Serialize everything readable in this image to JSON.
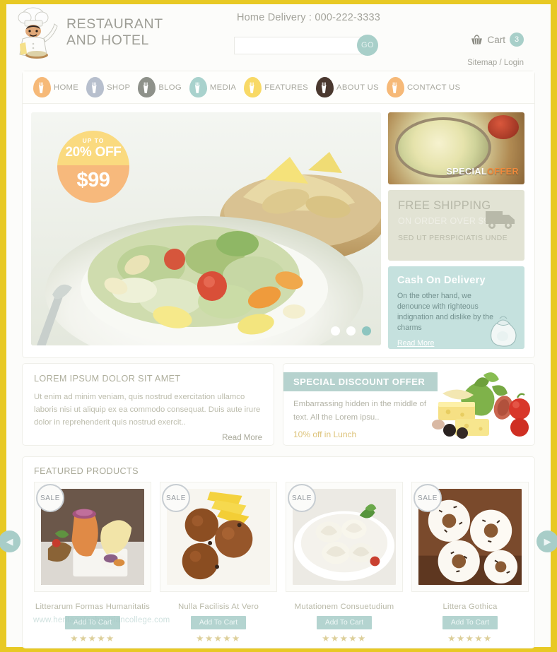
{
  "brand": {
    "logo_line1": "RESTAURANT",
    "logo_line2": "AND HOTEL",
    "chef_icon": "chef-icon"
  },
  "header": {
    "delivery_text": "Home Delivery : 000-222-3333",
    "search": {
      "value": "",
      "placeholder": "",
      "go_label": "GO"
    },
    "cart": {
      "icon": "basket-icon",
      "label": "Cart",
      "count": "3"
    },
    "meta": {
      "sitemap": "Sitemap",
      "separator": "/",
      "login": "Login"
    }
  },
  "nav": {
    "items": [
      {
        "label": "HOME",
        "color": "#f6b978"
      },
      {
        "label": "SHOP",
        "color": "#b7bfcd"
      },
      {
        "label": "BLOG",
        "color": "#8e918a"
      },
      {
        "label": "MEDIA",
        "color": "#a9d2cd"
      },
      {
        "label": "FEATURES",
        "color": "#f8d966"
      },
      {
        "label": "ABOUT US",
        "color": "#4a382f"
      },
      {
        "label": "CONTACT US",
        "color": "#f6b978"
      }
    ]
  },
  "slider": {
    "badge": {
      "upto": "UP TO",
      "percent": "20% OFF",
      "price": "$99"
    },
    "dots": [
      {
        "name": "slide-1",
        "active": false
      },
      {
        "name": "slide-2",
        "active": false
      },
      {
        "name": "slide-3",
        "active": true
      }
    ],
    "prev_arrow": "◀",
    "next_arrow": "▶"
  },
  "side_panels": {
    "special_offer": {
      "word1": "SPECIAL",
      "word2": "OFFER"
    },
    "free_shipping": {
      "line1": "FREE SHIPPING",
      "line2": "ON ORDER OVER $99",
      "line3": "SED UT PERSPICIATIS UNDE",
      "icon": "truck-icon"
    },
    "cash_on_delivery": {
      "title": "Cash On Delivery",
      "body": "On the other hand, we denounce with righteous indignation and dislike by the charms",
      "read_more": "Read More",
      "icon": "money-bag-icon"
    }
  },
  "promo_boxes": {
    "left": {
      "title": "LOREM IPSUM DOLOR SIT AMET",
      "body": "Ut enim ad minim veniam, quis nostrud exercitation ullamco laboris nisi ut aliquip ex ea commodo consequat. Duis aute irure dolor in reprehenderit quis nostrud exercit..",
      "read_more": "Read More"
    },
    "right": {
      "ribbon": "SPECIAL DISCOUNT OFFER",
      "body": "Embarrassing hidden in the middle of text. All the Lorem ipsu..",
      "offer": "10% off in Lunch"
    }
  },
  "featured": {
    "title": "FEATURED PRODUCTS",
    "sale_badge": "SALE",
    "add_to_cart": "Add To Cart",
    "stars": "★★★★★",
    "products": [
      {
        "name": "Litterarum Formas Humanitatis"
      },
      {
        "name": "Nulla Facilisis At Vero"
      },
      {
        "name": "Mutationem Consuetudium"
      },
      {
        "name": "Littera Gothica"
      }
    ]
  },
  "watermark": "www.heritagetechnstriancollege.com",
  "colors": {
    "frame": "#e8c924",
    "teal": "#a8cfc9",
    "orange": "#f6b978",
    "yellow": "#f8d966"
  }
}
